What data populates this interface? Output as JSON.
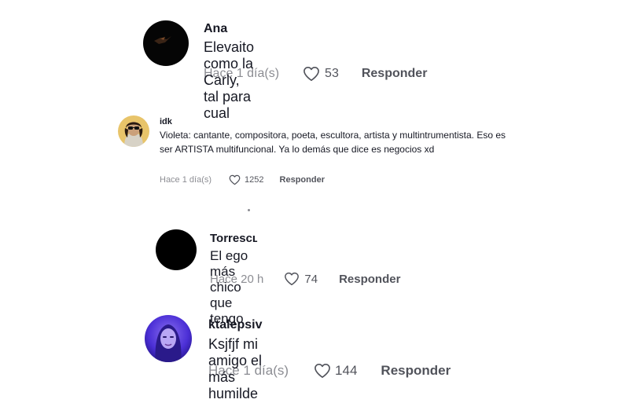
{
  "comments": [
    {
      "username": "Ana",
      "text": "Elevaito como la Carly, tal para cual",
      "time": "Hace 1 día(s)",
      "likes": "53",
      "reply_label": "Responder",
      "avatar_icon": "dark-photo-avatar"
    },
    {
      "username": "idk",
      "text": "Violeta: cantante, compositora, poeta, escultora, artista y multintrumentista. Eso es ser ARTISTA multifuncional. Ya lo demás que dice es negocios xd",
      "time": "Hace 1 día(s)",
      "likes": "1252",
      "reply_label": "Responder",
      "avatar_icon": "sunglasses-person-avatar"
    },
    {
      "username": "Torresᴄʟ",
      "text": "El ego más chico que tengo",
      "time": "Hace 20 h",
      "likes": "74",
      "reply_label": "Responder",
      "avatar_icon": "black-circle-avatar"
    },
    {
      "username": "ktalepsiv",
      "text": "Ksjfjf mi amigo el más humilde",
      "time": "Hace 1 día(s)",
      "likes": "144",
      "reply_label": "Responder",
      "avatar_icon": "purple-portrait-avatar"
    }
  ],
  "colors": {
    "text": "#161823",
    "muted": "#8a8b91",
    "background": "#ffffff"
  },
  "icons": {
    "like": "heart-outline-icon"
  }
}
